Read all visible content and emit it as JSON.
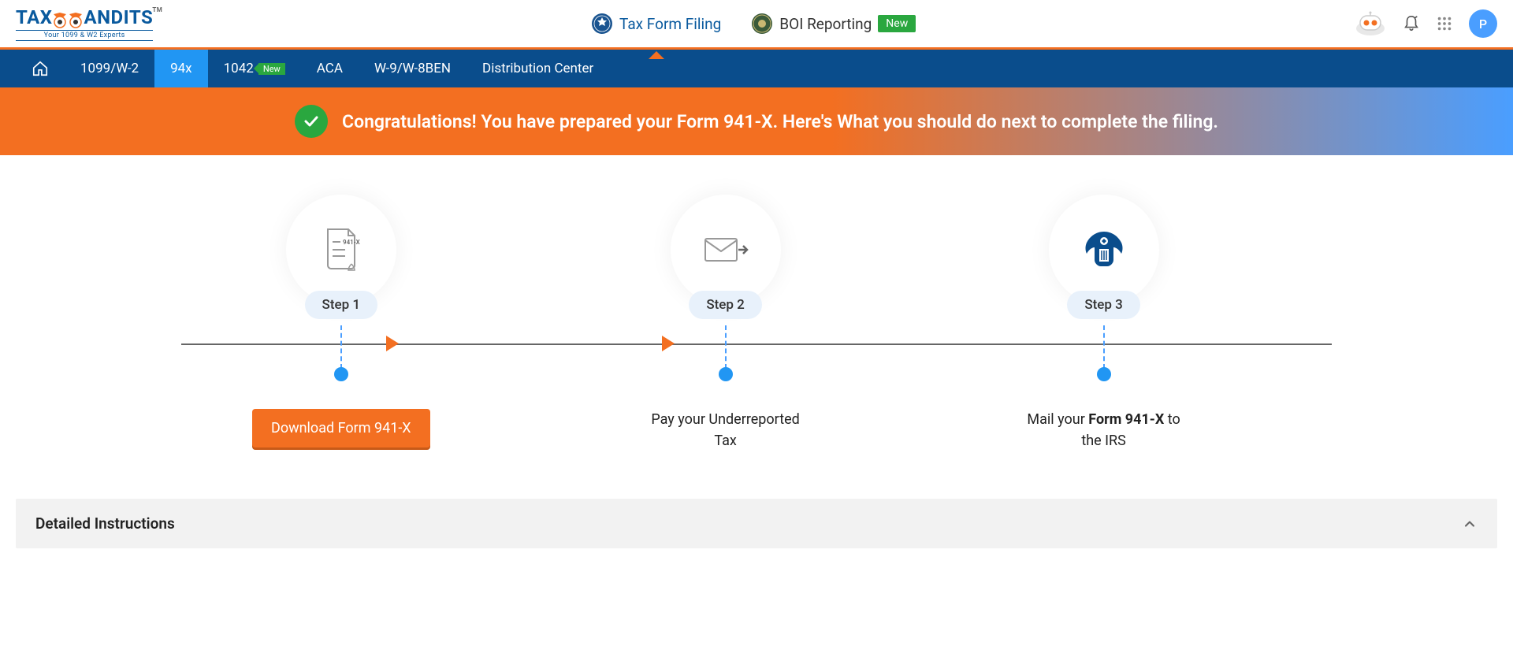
{
  "logo": {
    "main": "TAX",
    "rest": "ANDITS",
    "tm": "TM",
    "sub": "Your 1099 & W2 Experts"
  },
  "header_tabs": {
    "tax_form_filing": "Tax Form Filing",
    "boi_reporting": "BOI Reporting",
    "new_badge": "New"
  },
  "avatar_letter": "P",
  "nav": {
    "item1": "1099/W-2",
    "item2": "94x",
    "item3": "1042",
    "item3_badge": "New",
    "item4": "ACA",
    "item5": "W-9/W-8BEN",
    "item6": "Distribution Center"
  },
  "banner_text": "Congratulations! You have prepared your Form 941-X. Here's What you should do next to complete the filing.",
  "steps": {
    "s1_label": "Step 1",
    "s1_button": "Download Form 941-X",
    "s1_doc_label": "941-X",
    "s2_label": "Step 2",
    "s2_desc": "Pay your Underreported Tax",
    "s3_label": "Step 3",
    "s3_desc_pre": "Mail your ",
    "s3_desc_bold": "Form 941-X",
    "s3_desc_post": " to the IRS"
  },
  "accordion_title": "Detailed Instructions"
}
